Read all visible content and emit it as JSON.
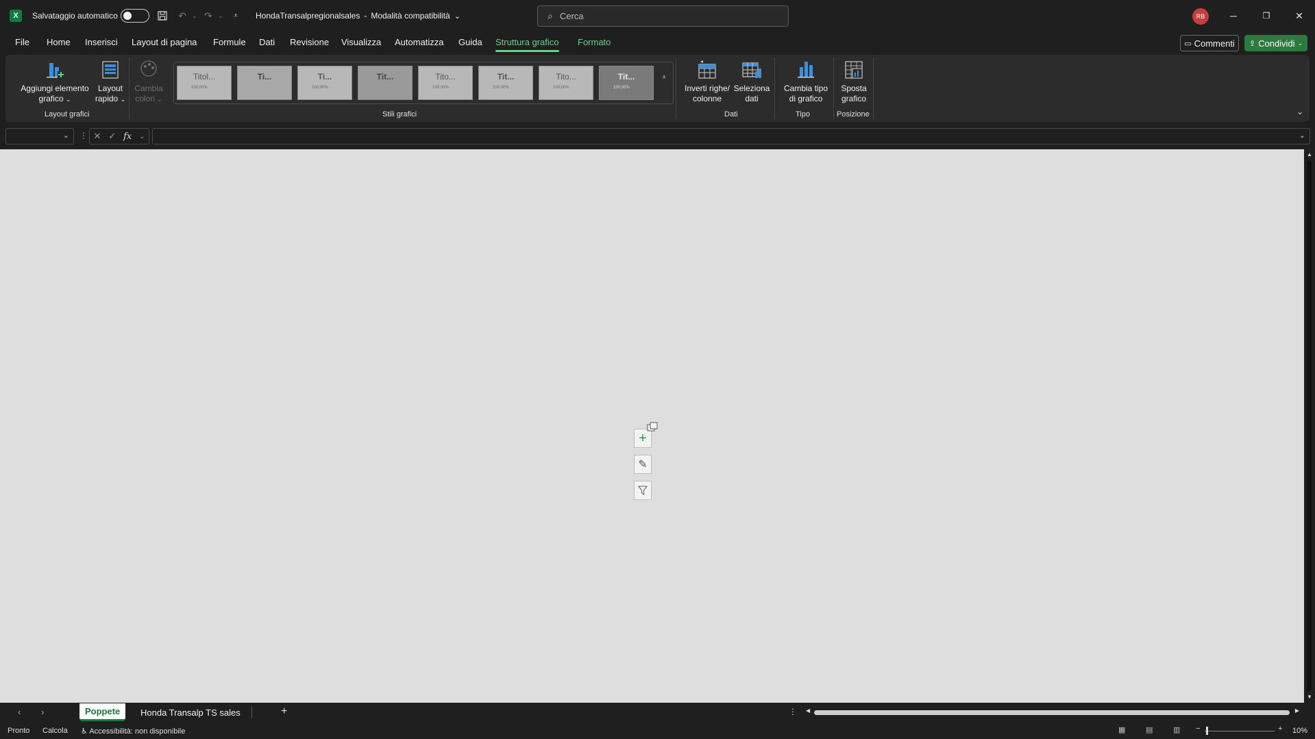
{
  "titlebar": {
    "autosave_label": "Salvataggio automatico",
    "doc_title": "HondaTransalpregionalsales",
    "mode": "Modalità compatibilità",
    "search_placeholder": "Cerca",
    "avatar_initials": "RB"
  },
  "menu": {
    "tabs": [
      "File",
      "Home",
      "Inserisci",
      "Layout di pagina",
      "Formule",
      "Dati",
      "Revisione",
      "Visualizza",
      "Automatizza",
      "Guida",
      "Struttura grafico",
      "Formato"
    ],
    "active_tab": "Struttura grafico",
    "comments_label": "Commenti",
    "share_label": "Condividi"
  },
  "ribbon": {
    "add_element_line1": "Aggiungi elemento",
    "add_element_line2": "grafico",
    "quick_layout_line1": "Layout",
    "quick_layout_line2": "rapido",
    "change_colors_line1": "Cambia",
    "change_colors_line2": "colori",
    "group_layout": "Layout grafici",
    "group_styles": "Stili grafici",
    "styles": [
      "Titol...",
      "Ti...",
      "Ti...",
      "Tit...",
      "Tito...",
      "Tit...",
      "Tito...",
      "Tit..."
    ],
    "style_value": "100,00%",
    "switch_rows_line1": "Inverti righe/",
    "switch_rows_line2": "colonne",
    "select_data_line1": "Seleziona",
    "select_data_line2": "dati",
    "group_data": "Dati",
    "change_type_line1": "Cambia tipo",
    "change_type_line2": "di grafico",
    "group_type": "Tipo",
    "move_chart_line1": "Sposta",
    "move_chart_line2": "grafico",
    "group_location": "Posizione"
  },
  "formula": {
    "fx": "fx"
  },
  "sheets": {
    "tabs": [
      "Poppete",
      "Honda Transalp TS sales"
    ],
    "active": "Poppete"
  },
  "status": {
    "ready": "Pronto",
    "calc": "Calcola",
    "accessibility": "Accessibilità: non disponibile",
    "zoom": "10%"
  }
}
